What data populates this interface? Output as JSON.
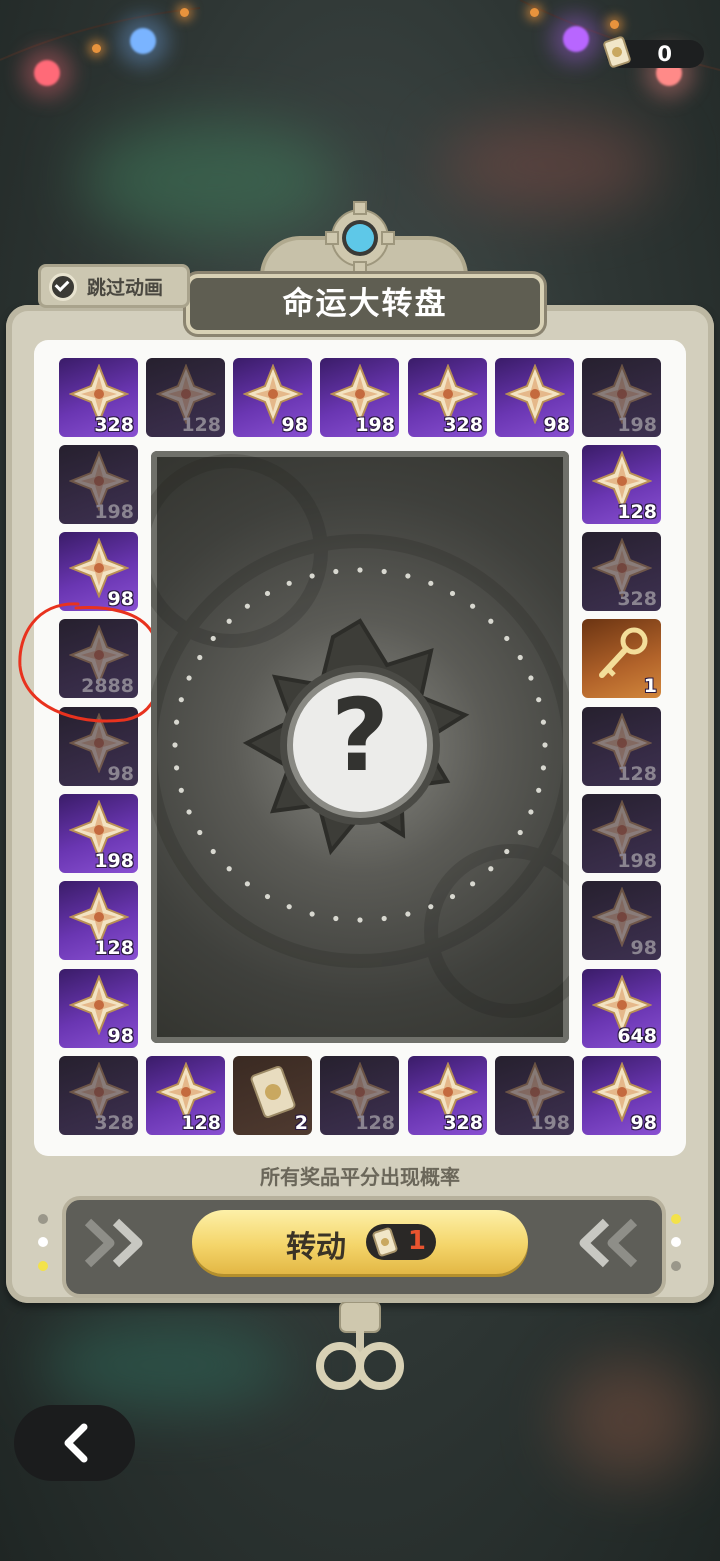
{
  "header": {
    "ticket_count": "0",
    "ticket_icon": "ticket-icon"
  },
  "skip_animation": {
    "label": "跳过动画",
    "checked": true
  },
  "title": "命运大转盘",
  "grid": {
    "top_row": [
      {
        "qty": "328",
        "state": "on",
        "icon": "primogem-icon"
      },
      {
        "qty": "128",
        "state": "off",
        "icon": "primogem-icon"
      },
      {
        "qty": "98",
        "state": "on",
        "icon": "primogem-icon"
      },
      {
        "qty": "198",
        "state": "on",
        "icon": "primogem-icon"
      },
      {
        "qty": "328",
        "state": "on",
        "icon": "primogem-icon"
      },
      {
        "qty": "98",
        "state": "on",
        "icon": "primogem-icon"
      },
      {
        "qty": "198",
        "state": "off",
        "icon": "primogem-icon"
      }
    ],
    "left_col": [
      {
        "qty": "198",
        "state": "off",
        "icon": "primogem-icon"
      },
      {
        "qty": "98",
        "state": "on",
        "icon": "primogem-icon"
      },
      {
        "qty": "2888",
        "state": "off",
        "icon": "primogem-icon"
      },
      {
        "qty": "98",
        "state": "off",
        "icon": "primogem-icon"
      },
      {
        "qty": "198",
        "state": "on",
        "icon": "primogem-icon"
      },
      {
        "qty": "128",
        "state": "on",
        "icon": "primogem-icon"
      },
      {
        "qty": "98",
        "state": "on",
        "icon": "primogem-icon"
      }
    ],
    "right_col": [
      {
        "qty": "128",
        "state": "on",
        "icon": "primogem-icon"
      },
      {
        "qty": "328",
        "state": "off",
        "icon": "primogem-icon"
      },
      {
        "qty": "1",
        "state": "gold",
        "icon": "key-icon"
      },
      {
        "qty": "128",
        "state": "off",
        "icon": "primogem-icon"
      },
      {
        "qty": "198",
        "state": "off",
        "icon": "primogem-icon"
      },
      {
        "qty": "98",
        "state": "off",
        "icon": "primogem-icon"
      },
      {
        "qty": "648",
        "state": "on",
        "icon": "primogem-icon"
      }
    ],
    "bottom_row": [
      {
        "qty": "328",
        "state": "off",
        "icon": "primogem-icon"
      },
      {
        "qty": "128",
        "state": "on",
        "icon": "primogem-icon"
      },
      {
        "qty": "2",
        "state": "card",
        "icon": "ticket-icon"
      },
      {
        "qty": "128",
        "state": "off",
        "icon": "primogem-icon"
      },
      {
        "qty": "328",
        "state": "on",
        "icon": "primogem-icon"
      },
      {
        "qty": "198",
        "state": "off",
        "icon": "primogem-icon"
      },
      {
        "qty": "98",
        "state": "on",
        "icon": "primogem-icon"
      }
    ],
    "highlighted_item": "2888"
  },
  "center": {
    "symbol": "?"
  },
  "probability_note": "所有奖品平分出现概率",
  "spin": {
    "label": "转动",
    "cost": "1"
  },
  "nav": {
    "back_icon": "chevron-left-icon"
  },
  "colors": {
    "accent_gold": "#f4d56a",
    "annotation_red": "#e8321e",
    "purple": "#6a36b2"
  }
}
